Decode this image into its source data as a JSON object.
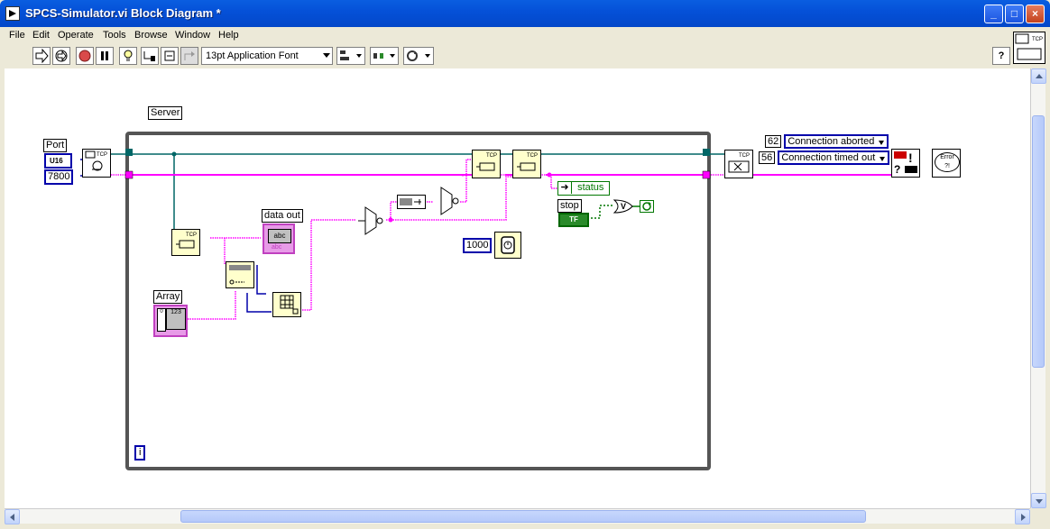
{
  "window": {
    "title": "SPCS-Simulator.vi Block Diagram *"
  },
  "menu": {
    "items": [
      "File",
      "Edit",
      "Operate",
      "Tools",
      "Browse",
      "Window",
      "Help"
    ]
  },
  "toolbar": {
    "font_label": "13pt Application Font",
    "help_label": "?"
  },
  "diagram": {
    "server_label": "Server",
    "port_label": "Port",
    "port_type": "U16",
    "port_value": "7800",
    "data_out_label": "data out",
    "data_out_type": "abc",
    "array_label": "Array",
    "array_type": "123",
    "array_index": "0",
    "wait_value": "1000",
    "status_label": "status",
    "stop_label": "stop",
    "stop_type": "TF",
    "iteration_label": "i",
    "error_code_1": "62",
    "error_text_1": "Connection aborted",
    "error_code_2": "56",
    "error_text_2": "Connection timed out",
    "error_node_label": "Error",
    "or_label": "V"
  },
  "colors": {
    "string_wire": "#ff00ff",
    "ref_wire": "#006666",
    "numeric_blue": "#0000aa",
    "boolean_green": "#007700",
    "loop_border": "#555555"
  },
  "icons": [
    "run-arrow-icon",
    "run-continuous-icon",
    "abort-icon",
    "pause-icon",
    "highlight-execution-icon",
    "retain-wire-icon",
    "step-into-icon",
    "step-over-icon",
    "step-out-icon",
    "align-icon",
    "distribute-icon",
    "reorder-icon"
  ]
}
